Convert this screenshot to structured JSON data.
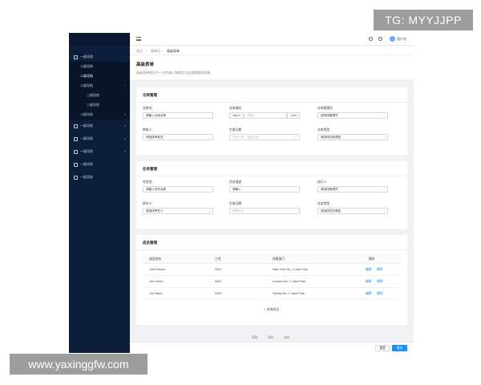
{
  "watermark_top": "TG: MYYJJPP",
  "watermark_bottom": "www.yaxinggfw.com",
  "sidebar": {
    "items": [
      {
        "label": "一级导航",
        "icon": "menu-icon"
      },
      {
        "label": "二级导航"
      },
      {
        "label": "二级导航"
      },
      {
        "label": "二级导航"
      },
      {
        "label": "三级导航"
      },
      {
        "label": "三级导航"
      },
      {
        "label": "二级导航"
      },
      {
        "label": "一级导航",
        "icon": "grid-icon"
      },
      {
        "label": "一级导航",
        "icon": "box-icon"
      },
      {
        "label": "一级导航",
        "icon": "layers-icon"
      },
      {
        "label": "一级导航",
        "icon": "shield-icon"
      },
      {
        "label": "一级导航",
        "icon": "users-icon"
      }
    ]
  },
  "header": {
    "username": "用户名",
    "breadcrumb": [
      "首页",
      "/",
      "表单页",
      "/",
      "高级表单"
    ]
  },
  "page": {
    "title": "高级表单",
    "description": "高级表单常见于一次性输入和提交大批量数据的场景。"
  },
  "warehouse": {
    "title": "仓库管理",
    "fields": [
      {
        "label": "仓库名",
        "value": "请输入仓库名称"
      },
      {
        "label": "仓库域名",
        "prefix": "http://",
        "placeholder": "请输入",
        "suffix": ".com"
      },
      {
        "label": "仓库管理员",
        "value": "请选择管理员"
      },
      {
        "label": "审批人",
        "value": "请选择审批员"
      },
      {
        "label": "生效日期",
        "placeholder": "开始日期 ~ 结束日期"
      },
      {
        "label": "仓库类型",
        "value": "请选择仓库类型"
      }
    ]
  },
  "task": {
    "title": "任务管理",
    "fields": [
      {
        "label": "任务名",
        "value": "请输入任务名称"
      },
      {
        "label": "任务描述",
        "value": "请输入"
      },
      {
        "label": "执行人",
        "value": "请选择管理员"
      },
      {
        "label": "责任人",
        "value": "请选择责任人"
      },
      {
        "label": "生效日期",
        "placeholder": "提醒时间"
      },
      {
        "label": "任务类型",
        "value": "请选择任务类型"
      }
    ]
  },
  "members": {
    "title": "成员管理",
    "columns": [
      "成员姓名",
      "工号",
      "所属部门",
      "操作"
    ],
    "rows": [
      {
        "name": "John Brown",
        "id": "0001",
        "dept": "New York No. 1 Lake Park",
        "edit": "编辑",
        "delete": "删除"
      },
      {
        "name": "Jim Green",
        "id": "0002",
        "dept": "London No. 1 Lake Park",
        "edit": "编辑",
        "delete": "删除"
      },
      {
        "name": "Joe Black",
        "id": "0003",
        "dept": "Sidney No. 1 Lake Park",
        "edit": "编辑",
        "delete": "删除"
      }
    ],
    "add_label": "+ 新增成员"
  },
  "footer": {
    "links": [
      "帮助",
      "隐私",
      "条款"
    ],
    "reset_label": "重置",
    "submit_label": "提交"
  },
  "colors": {
    "primary": "#1890ff",
    "sidebar_bg": "#0d1e3b"
  }
}
